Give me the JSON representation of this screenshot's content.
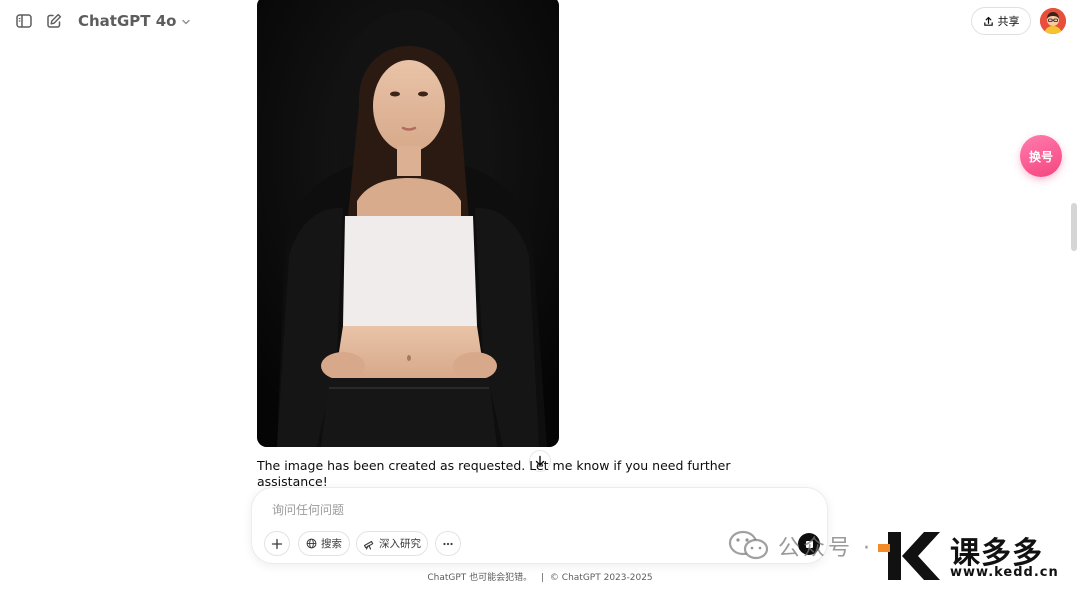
{
  "header": {
    "model_name": "ChatGPT 4o",
    "share_label": "共享"
  },
  "conversation": {
    "assistant_text": "The image has been created as requested. Let me know if you need further assistance!"
  },
  "composer": {
    "placeholder": "询问任何问题",
    "search_label": "搜索",
    "research_label": "深入研究"
  },
  "footer": {
    "disclaimer": "ChatGPT 也可能会犯错。",
    "separator": "|",
    "copyright": "ChatGPT 2023-2025"
  },
  "floating": {
    "switch_label": "换号"
  },
  "watermark": {
    "wechat_text": "公众号 ·",
    "brand": "课多多",
    "url": "www.kedd.cn"
  },
  "colors": {
    "accent_pink": "#f5457f",
    "stop_button": "#0d0d0d"
  },
  "icons": [
    "sidebar-toggle-icon",
    "new-chat-icon",
    "chevron-down-icon",
    "share-icon",
    "arrow-down-icon",
    "plus-icon",
    "globe-icon",
    "telescope-icon",
    "ellipsis-icon",
    "stop-icon",
    "wechat-icon"
  ]
}
